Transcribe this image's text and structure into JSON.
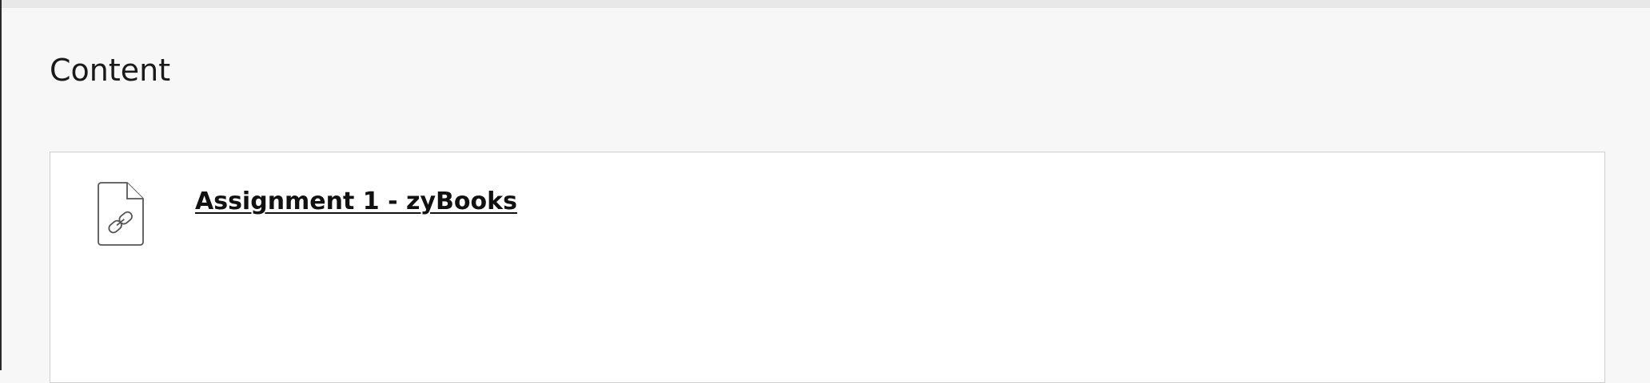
{
  "header": {
    "title": "Content"
  },
  "content": {
    "items": [
      {
        "title": "Assignment 1 - zyBooks",
        "icon": "link-document-icon"
      }
    ]
  },
  "colors": {
    "page_background": "#f7f7f7",
    "panel_background": "#ffffff",
    "panel_border": "#cfcfcf",
    "text": "#111111"
  }
}
